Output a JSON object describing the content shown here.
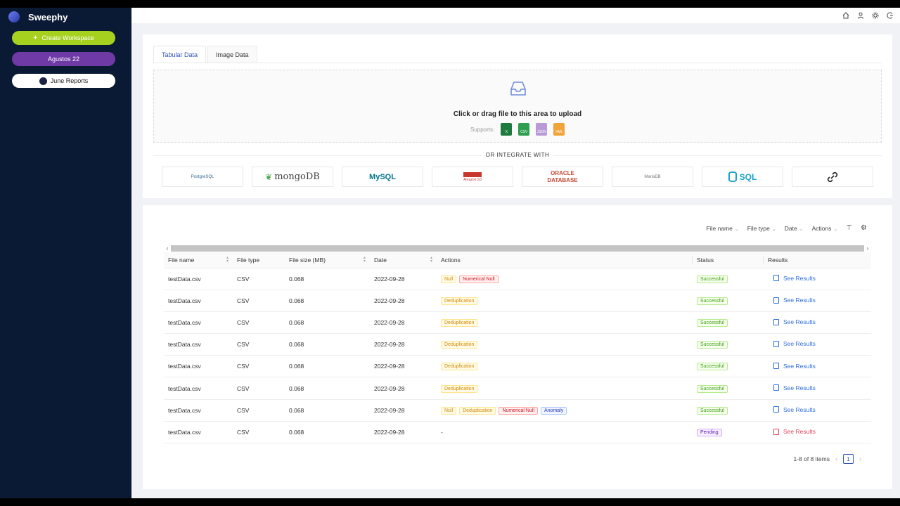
{
  "app": {
    "name": "Sweephy"
  },
  "sidebar": {
    "create_label": "Create Workspace",
    "workspace_label": "Agustos 22",
    "june_label": "June Reports"
  },
  "topbar": {
    "icons": [
      "home-icon",
      "user-icon",
      "gear-icon",
      "logout-icon"
    ]
  },
  "upload": {
    "tabs": [
      "Tabular Data",
      "Image Data"
    ],
    "title": "Click or drag file to this area to upload",
    "supports_label": "Supports:",
    "file_types": [
      "xlsx",
      "CSV",
      "JSON",
      "XML"
    ],
    "integrate_label": "OR INTEGRATE WITH",
    "integrations": [
      "PostgreSQL",
      "mongoDB",
      "MySQL",
      "Amazon S3",
      "ORACLE DATABASE",
      "MariaDB",
      "SQL",
      "link"
    ]
  },
  "filters": [
    "File name",
    "File type",
    "Date",
    "Actions"
  ],
  "table": {
    "columns": [
      "File name",
      "File type",
      "File size (MB)",
      "Date",
      "Actions",
      "Status",
      "Results"
    ],
    "rows": [
      {
        "name": "testData.csv",
        "type": "CSV",
        "size": "0.068",
        "date": "2022-09-28",
        "actions": [
          "Null",
          "Numerical Null"
        ],
        "status": "Successful",
        "result": "See Results"
      },
      {
        "name": "testData.csv",
        "type": "CSV",
        "size": "0.068",
        "date": "2022-09-28",
        "actions": [
          "Deduplication"
        ],
        "status": "Successful",
        "result": "See Results"
      },
      {
        "name": "testData.csv",
        "type": "CSV",
        "size": "0.068",
        "date": "2022-09-28",
        "actions": [
          "Deduplication"
        ],
        "status": "Successful",
        "result": "See Results"
      },
      {
        "name": "testData.csv",
        "type": "CSV",
        "size": "0.068",
        "date": "2022-09-28",
        "actions": [
          "Deduplication"
        ],
        "status": "Successful",
        "result": "See Results"
      },
      {
        "name": "testData.csv",
        "type": "CSV",
        "size": "0.068",
        "date": "2022-09-28",
        "actions": [
          "Deduplication"
        ],
        "status": "Successful",
        "result": "See Results"
      },
      {
        "name": "testData.csv",
        "type": "CSV",
        "size": "0.068",
        "date": "2022-09-28",
        "actions": [
          "Deduplication"
        ],
        "status": "Successful",
        "result": "See Results"
      },
      {
        "name": "testData.csv",
        "type": "CSV",
        "size": "0.068",
        "date": "2022-09-28",
        "actions": [
          "Null",
          "Deduplication",
          "Numerical Null",
          "Anomaly"
        ],
        "status": "Successful",
        "result": "See Results"
      },
      {
        "name": "testData.csv",
        "type": "CSV",
        "size": "0.068",
        "date": "2022-09-28",
        "actions": [
          "-"
        ],
        "status": "Pending",
        "result": "See Results"
      }
    ]
  },
  "pagination": {
    "summary": "1-8 of 8 items",
    "current": "1"
  },
  "colors": {
    "sidebar": "#0b1a34",
    "create": "#a6d11f",
    "workspace": "#6f3aa6",
    "accent": "#2f54b6"
  }
}
